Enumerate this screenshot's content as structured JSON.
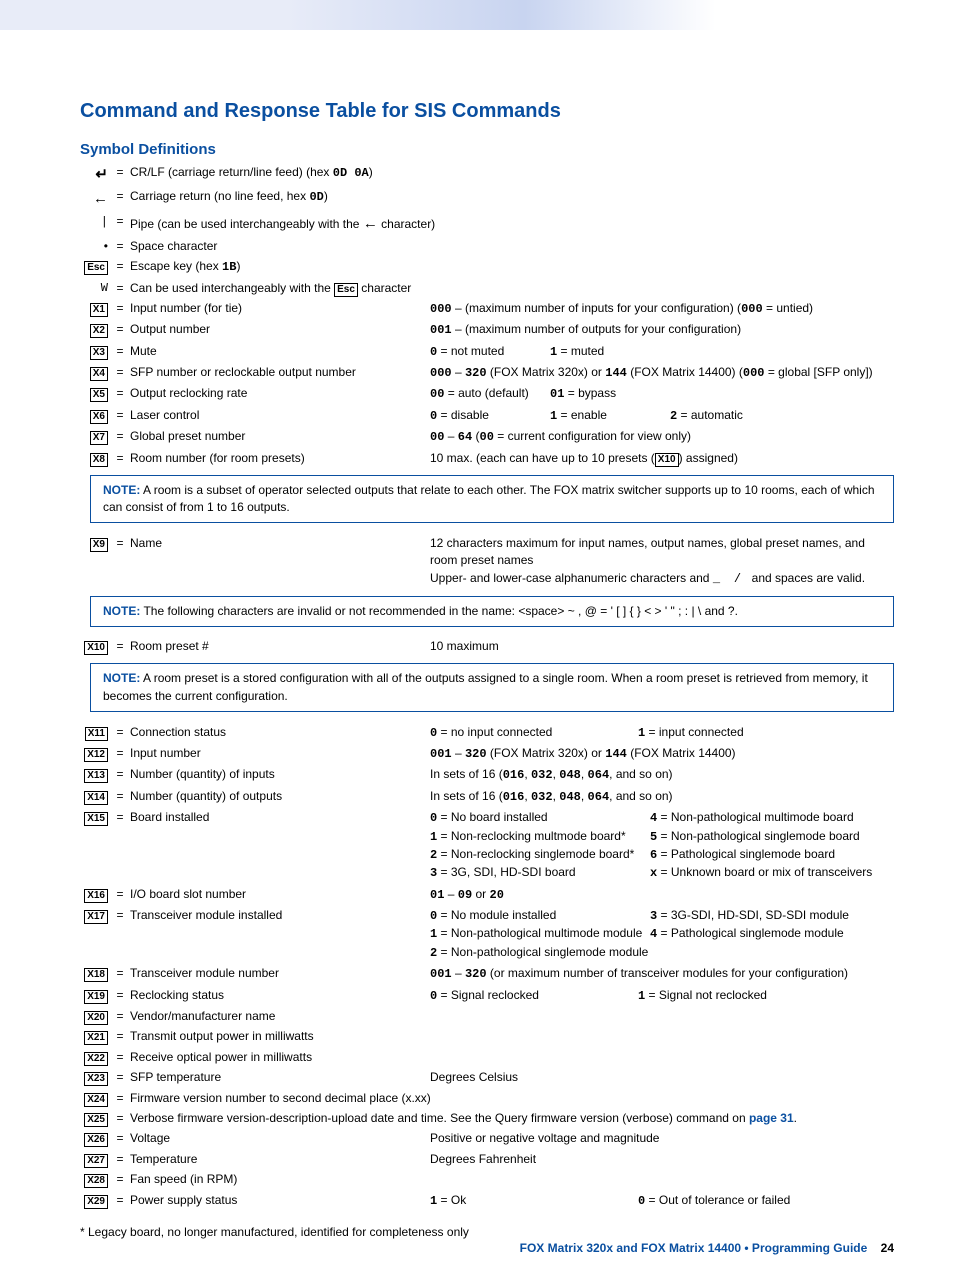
{
  "title": "Command and Response Table for SIS Commands",
  "subtitle": "Symbol Definitions",
  "symbols": {
    "crlf": "CR/LF (carriage return/line feed) (hex ",
    "crlf_hex": "0D 0A",
    "cr": "Carriage return (no line feed, hex ",
    "cr_hex": "0D",
    "pipe": "Pipe (can be used interchangeably with the ",
    "pipe_suffix": " character)",
    "space": "Space character",
    "esc": "Escape key (hex ",
    "esc_hex": "1B",
    "w_sym": "W",
    "w": "Can be used interchangeably with the ",
    "w_suffix": " character",
    "esc_label": "Esc"
  },
  "x": {
    "1": {
      "label": "X1",
      "desc": "Input number (for tie)",
      "v1a": "000",
      "v1b": " – (maximum number of inputs for your configuration) (",
      "v1c": "000",
      "v1d": " = untied)"
    },
    "2": {
      "label": "X2",
      "desc": "Output number",
      "v1a": "001",
      "v1b": " – (maximum number of outputs for your configuration)"
    },
    "3": {
      "label": "X3",
      "desc": "Mute",
      "v1a": "0",
      "v1b": " = not muted",
      "v2a": "1",
      "v2b": " = muted"
    },
    "4": {
      "label": "X4",
      "desc": "SFP number or reclockable output number",
      "v1a": "000",
      "v1b": " – ",
      "v1c": "320",
      "v1d": " (FOX Matrix 320x) or ",
      "v1e": "144",
      "v1f": " (FOX Matrix 14400) (",
      "v1g": "000",
      "v1h": " = global [SFP only])"
    },
    "5": {
      "label": "X5",
      "desc": "Output reclocking rate",
      "v1a": "00",
      "v1b": " = auto (default)",
      "v2a": "01",
      "v2b": " = bypass"
    },
    "6": {
      "label": "X6",
      "desc": "Laser control",
      "v1a": "0",
      "v1b": " = disable",
      "v2a": "1",
      "v2b": " = enable",
      "v3a": "2",
      "v3b": " = automatic"
    },
    "7": {
      "label": "X7",
      "desc": "Global preset number",
      "v1a": "00",
      "v1b": " – ",
      "v1c": "64",
      "v1d": " (",
      "v1e": "00",
      "v1f": " = current configuration for view only)"
    },
    "8": {
      "label": "X8",
      "desc": "Room number (for room presets)",
      "v1": "10 max. (each can have up to 10 presets (",
      "v1box": "X10",
      "v1suf": ") assigned)"
    },
    "9": {
      "label": "X9",
      "desc": "Name",
      "v1": "12 characters maximum for input names, output names, global preset names, and room preset names",
      "v2": "Upper- and lower-case alphanumeric characters and ",
      "v2b": "_",
      "v2c": " / ",
      "v2d": "and spaces are valid."
    },
    "10": {
      "label": "X10",
      "desc": "Room preset #",
      "v1": "10 maximum"
    },
    "11": {
      "label": "X11",
      "desc": "Connection status",
      "v1a": "0",
      "v1b": " = no input connected",
      "v2a": "1",
      "v2b": " = input connected"
    },
    "12": {
      "label": "X12",
      "desc": "Input number",
      "v1a": "001",
      "v1b": " – ",
      "v1c": "320",
      "v1d": " (FOX Matrix 320x) or ",
      "v1e": "144",
      "v1f": " (FOX Matrix 14400)"
    },
    "13": {
      "label": "X13",
      "desc": "Number (quantity) of inputs",
      "v1": "In sets of 16 (",
      "v1a": "016",
      "v1b": ", ",
      "v1c": "032",
      "v1d": ", ",
      "v1e": "048",
      "v1f": ", ",
      "v1g": "064",
      "v1h": ", and so on)"
    },
    "14": {
      "label": "X14",
      "desc": "Number (quantity) of outputs",
      "v1": "In sets of 16 (",
      "v1a": "016",
      "v1b": ", ",
      "v1c": "032",
      "v1d": ", ",
      "v1e": "048",
      "v1f": ", ",
      "v1g": "064",
      "v1h": ", and so on)"
    },
    "15": {
      "label": "X15",
      "desc": "Board installed",
      "c0a": "0",
      "c0b": " = No board installed",
      "c1a": "1",
      "c1b": " = Non-reclocking multmode board*",
      "c2a": "2",
      "c2b": " = Non-reclocking singlemode board*",
      "c3a": "3",
      "c3b": " = 3G, SDI, HD-SDI board",
      "c4a": "4",
      "c4b": " = Non-pathological multimode board",
      "c5a": "5",
      "c5b": " = Non-pathological singlemode board",
      "c6a": "6",
      "c6b": " = Pathological singlemode board",
      "cxa": "x",
      "cxb": " = Unknown board or mix of transceivers"
    },
    "16": {
      "label": "X16",
      "desc": "I/O board slot number",
      "v1a": "01",
      "v1b": " – ",
      "v1c": "09",
      "v1d": " or ",
      "v1e": "20"
    },
    "17": {
      "label": "X17",
      "desc": "Transceiver module installed",
      "c0a": "0",
      "c0b": " = No module installed",
      "c1a": "1",
      "c1b": " = Non-pathological multimode module",
      "c2a": "2",
      "c2b": " = Non-pathological singlemode module",
      "c3a": "3",
      "c3b": " = 3G-SDI, HD-SDI, SD-SDI module",
      "c4a": "4",
      "c4b": " = Pathological singlemode module"
    },
    "18": {
      "label": "X18",
      "desc": "Transceiver module number",
      "v1a": "001",
      "v1b": " – ",
      "v1c": "320",
      "v1d": " (or maximum number of transceiver modules for your configuration)"
    },
    "19": {
      "label": "X19",
      "desc": "Reclocking status",
      "v1a": "0",
      "v1b": " = Signal reclocked",
      "v2a": "1",
      "v2b": " = Signal not reclocked"
    },
    "20": {
      "label": "X20",
      "desc": "Vendor/manufacturer name"
    },
    "21": {
      "label": "X21",
      "desc": "Transmit output power in milliwatts"
    },
    "22": {
      "label": "X22",
      "desc": "Receive optical power in milliwatts"
    },
    "23": {
      "label": "X23",
      "desc": "SFP temperature",
      "v1": "Degrees Celsius"
    },
    "24": {
      "label": "X24",
      "desc": "Firmware version number to second decimal place (x.xx)"
    },
    "25": {
      "label": "X25",
      "desc_pre": "Verbose firmware version-description-upload date and time. See the Query firmware version (verbose) command on ",
      "link": "page 31",
      "desc_post": "."
    },
    "26": {
      "label": "X26",
      "desc": "Voltage",
      "v1": "Positive or negative voltage and magnitude"
    },
    "27": {
      "label": "X27",
      "desc": "Temperature",
      "v1": "Degrees Fahrenheit"
    },
    "28": {
      "label": "X28",
      "desc": "Fan speed (in RPM)"
    },
    "29": {
      "label": "X29",
      "desc": "Power supply status",
      "v1a": "1",
      "v1b": " = Ok",
      "v2a": "0",
      "v2b": " = Out of tolerance or failed"
    }
  },
  "notes": {
    "n1_label": "NOTE:",
    "n1": "A room is a subset of operator selected outputs that relate to each other. The FOX matrix switcher supports up to 10 rooms, each of which can consist of from 1 to 16 outputs.",
    "n2_label": "NOTE:",
    "n2": "The following characters are invalid or not recommended in the name: <space>  ~ , @ = ' [ ] { } < > ' \" ; :  |  \\ and ?.",
    "n3_label": "NOTE:",
    "n3": "A room preset is a stored configuration with all of the outputs assigned to a single room. When a room preset is retrieved from memory, it becomes the current configuration."
  },
  "footnote": "* Legacy board, no longer manufactured, identified for completeness only",
  "footer": {
    "text": "FOX Matrix 320x and FOX Matrix 14400 • Programming Guide",
    "page": "24"
  }
}
